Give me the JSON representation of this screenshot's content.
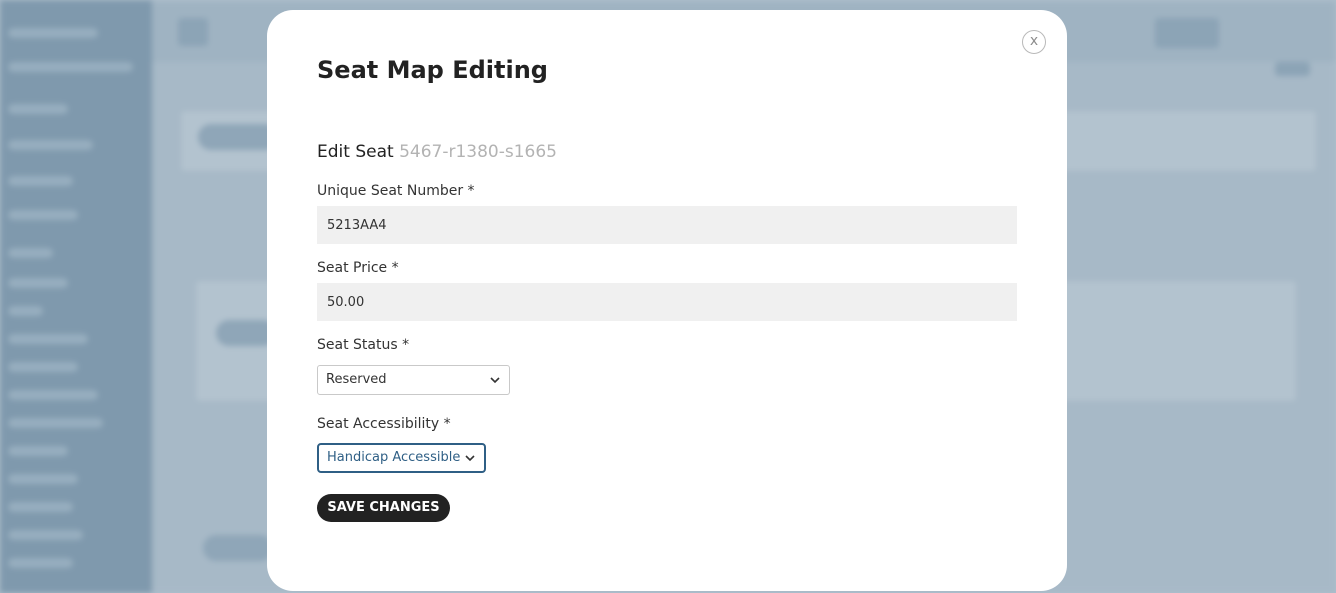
{
  "modal": {
    "title": "Seat Map Editing",
    "close_label": "x",
    "edit_heading": "Edit Seat",
    "seat_id": "5467-r1380-s1665"
  },
  "form": {
    "unique_seat_number": {
      "label": "Unique Seat Number *",
      "value": "5213AA4"
    },
    "seat_price": {
      "label": "Seat Price *",
      "value": "50.00"
    },
    "seat_status": {
      "label": "Seat Status *",
      "selected": "Reserved"
    },
    "seat_accessibility": {
      "label": "Seat Accessibility *",
      "selected": "Handicap Accessible"
    },
    "save_label": "SAVE CHANGES"
  },
  "colors": {
    "overlay": "#aebfcc",
    "focus_accent": "#2f5f85",
    "save_button": "#222222"
  },
  "icons": {
    "close": "close-icon",
    "select_chevron": "chevron-down-icon"
  }
}
